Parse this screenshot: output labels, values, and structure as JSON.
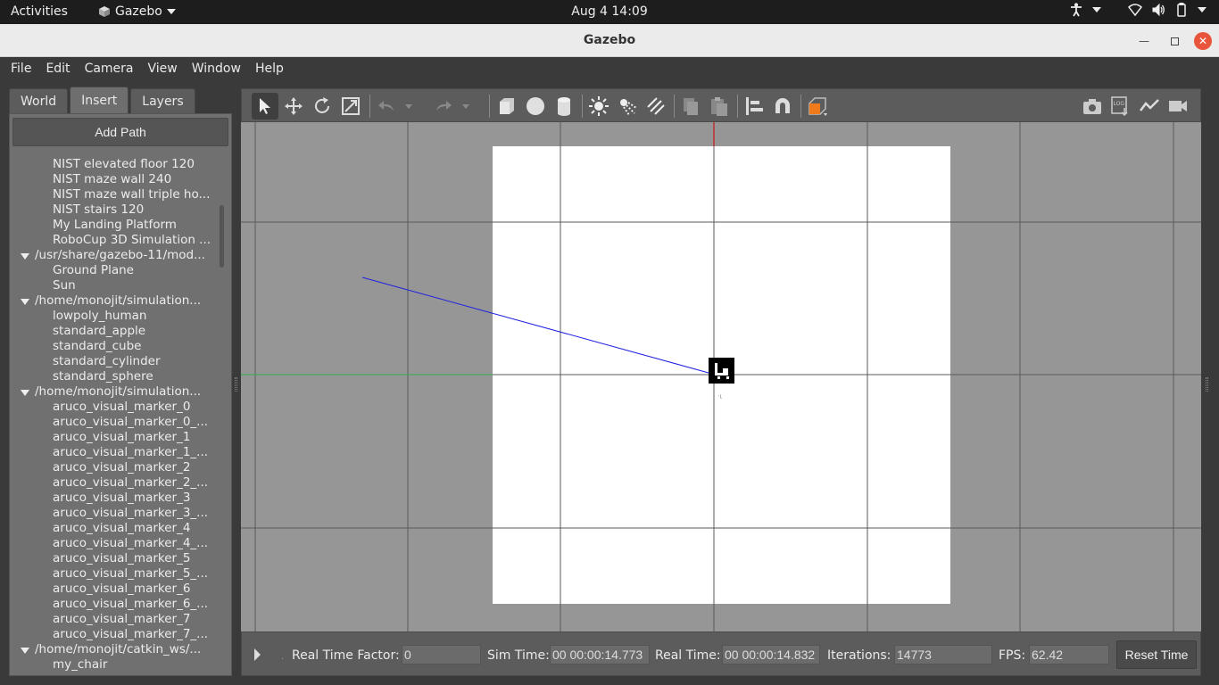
{
  "topbar": {
    "activities": "Activities",
    "app_name": "Gazebo",
    "clock": "Aug 4  14:09"
  },
  "window": {
    "title": "Gazebo"
  },
  "menubar": {
    "items": [
      "File",
      "Edit",
      "Camera",
      "View",
      "Window",
      "Help"
    ]
  },
  "left_panel": {
    "tabs": [
      "World",
      "Insert",
      "Layers"
    ],
    "active_tab": "Insert",
    "add_path_label": "Add Path",
    "tree": [
      {
        "kind": "child",
        "label": "NIST elevated floor 120"
      },
      {
        "kind": "child",
        "label": "NIST maze wall 240"
      },
      {
        "kind": "child",
        "label": "NIST maze wall triple ho..."
      },
      {
        "kind": "child",
        "label": "NIST stairs 120"
      },
      {
        "kind": "child",
        "label": "My Landing Platform"
      },
      {
        "kind": "child",
        "label": "RoboCup 3D Simulation ..."
      },
      {
        "kind": "header",
        "label": "/usr/share/gazebo-11/mod..."
      },
      {
        "kind": "child",
        "label": "Ground Plane"
      },
      {
        "kind": "child",
        "label": "Sun"
      },
      {
        "kind": "header",
        "label": "/home/monojit/simulation..."
      },
      {
        "kind": "child",
        "label": "lowpoly_human"
      },
      {
        "kind": "child",
        "label": "standard_apple"
      },
      {
        "kind": "child",
        "label": "standard_cube"
      },
      {
        "kind": "child",
        "label": "standard_cylinder"
      },
      {
        "kind": "child",
        "label": "standard_sphere"
      },
      {
        "kind": "header",
        "label": "/home/monojit/simulation..."
      },
      {
        "kind": "child",
        "label": "aruco_visual_marker_0"
      },
      {
        "kind": "child",
        "label": "aruco_visual_marker_0_..."
      },
      {
        "kind": "child",
        "label": "aruco_visual_marker_1"
      },
      {
        "kind": "child",
        "label": "aruco_visual_marker_1_..."
      },
      {
        "kind": "child",
        "label": "aruco_visual_marker_2"
      },
      {
        "kind": "child",
        "label": "aruco_visual_marker_2_..."
      },
      {
        "kind": "child",
        "label": "aruco_visual_marker_3"
      },
      {
        "kind": "child",
        "label": "aruco_visual_marker_3_..."
      },
      {
        "kind": "child",
        "label": "aruco_visual_marker_4"
      },
      {
        "kind": "child",
        "label": "aruco_visual_marker_4_..."
      },
      {
        "kind": "child",
        "label": "aruco_visual_marker_5"
      },
      {
        "kind": "child",
        "label": "aruco_visual_marker_5_..."
      },
      {
        "kind": "child",
        "label": "aruco_visual_marker_6"
      },
      {
        "kind": "child",
        "label": "aruco_visual_marker_6_..."
      },
      {
        "kind": "child",
        "label": "aruco_visual_marker_7"
      },
      {
        "kind": "child",
        "label": "aruco_visual_marker_7_..."
      },
      {
        "kind": "header",
        "label": "/home/monojit/catkin_ws/..."
      },
      {
        "kind": "child",
        "label": "my_chair"
      }
    ]
  },
  "toolbar": {
    "tools": [
      "select-arrow",
      "translate",
      "rotate",
      "scale",
      "undo",
      "redo",
      "box",
      "sphere",
      "cylinder",
      "point-light",
      "spot-light",
      "directional-light",
      "copy",
      "paste",
      "align",
      "snap",
      "view-angle",
      "screenshot",
      "log",
      "plot",
      "record-video"
    ]
  },
  "status": {
    "real_time_factor_label": "Real Time Factor:",
    "real_time_factor": "0",
    "sim_time_label": "Sim Time:",
    "sim_time": "00 00:00:14.773",
    "real_time_label": "Real Time:",
    "real_time": "00 00:00:14.832",
    "iterations_label": "Iterations:",
    "iterations": "14773",
    "fps_label": "FPS:",
    "fps": "62.42",
    "reset_label": "Reset Time"
  },
  "colors": {
    "viewport_bg": "#969696",
    "ground_plane": "#ffffff",
    "x_axis": "#cc0000",
    "y_axis": "#2fb34a",
    "ray": "#1f1fe0",
    "panel": "#707070",
    "toolbar": "#5c5c5c"
  }
}
